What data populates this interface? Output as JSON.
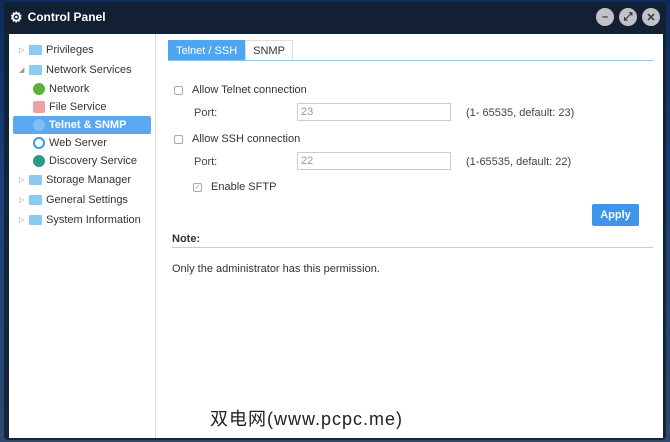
{
  "window": {
    "title": "Control Panel"
  },
  "sidebar": {
    "items": [
      {
        "label": "Privileges"
      },
      {
        "label": "Network Services"
      },
      {
        "label": "Network"
      },
      {
        "label": "File Service"
      },
      {
        "label": "Telnet & SNMP"
      },
      {
        "label": "Web Server"
      },
      {
        "label": "Discovery Service"
      },
      {
        "label": "Storage Manager"
      },
      {
        "label": "General Settings"
      },
      {
        "label": "System Information"
      }
    ]
  },
  "tabs": [
    {
      "label": "Telnet / SSH"
    },
    {
      "label": "SNMP"
    }
  ],
  "telnet": {
    "label": "Allow Telnet connection",
    "port_label": "Port:",
    "port_value": "23",
    "hint": "(1- 65535, default: 23)",
    "checked": false
  },
  "ssh": {
    "label": "Allow SSH connection",
    "port_label": "Port:",
    "port_value": "22",
    "hint": "(1-65535, default: 22)",
    "checked": false
  },
  "sftp": {
    "label": "Enable SFTP",
    "checked": true
  },
  "apply_label": "Apply",
  "note": {
    "title": "Note:",
    "text": "Only the administrator has this permission."
  },
  "watermark": "双电网(www.pcpc.me)"
}
